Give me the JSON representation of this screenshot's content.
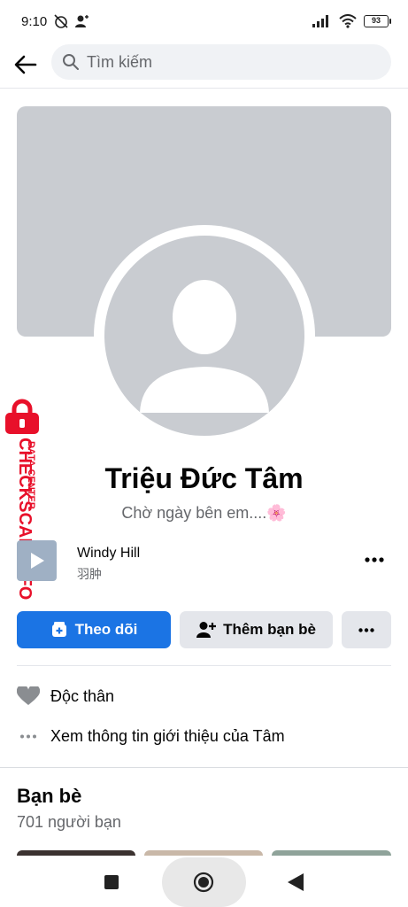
{
  "status_bar": {
    "time": "9:10",
    "battery": "93"
  },
  "search": {
    "placeholder": "Tìm kiếm"
  },
  "profile": {
    "name": "Triệu Đức Tâm",
    "bio": "Chờ ngày bên em....🌸"
  },
  "music": {
    "title": "Windy Hill",
    "artist": "羽肿"
  },
  "actions": {
    "follow_label": "Theo dõi",
    "add_friend_label": "Thêm bạn bè"
  },
  "intro": {
    "relationship": "Độc thân",
    "see_info": "Xem thông tin giới thiệu của Tâm"
  },
  "friends": {
    "title": "Bạn bè",
    "count": "701 người bạn"
  },
  "watermark": {
    "line1": "DATA CENTER",
    "line2": "CHECKSCAM.INFO"
  },
  "colors": {
    "accent": "#1b74e4",
    "cover": "#c9ccd1",
    "watermark": "#e8102a"
  },
  "icons": [
    "back-arrow-icon",
    "search-icon",
    "play-icon",
    "more-icon",
    "follow-icon",
    "add-friend-icon",
    "heart-icon",
    "dots-icon",
    "lock-icon",
    "recent-apps-icon",
    "home-icon",
    "back-icon"
  ]
}
